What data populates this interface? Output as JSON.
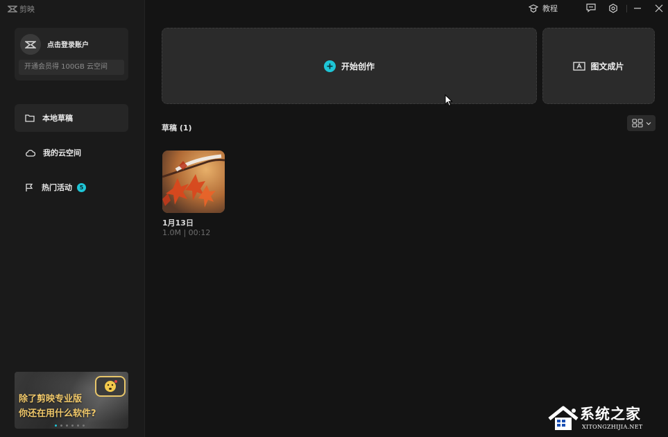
{
  "app": {
    "name": "剪映"
  },
  "account": {
    "login_label": "点击登录账户",
    "vip_promo": "开通会员得 100GB 云空间"
  },
  "sidebar": {
    "items": [
      {
        "label": "本地草稿",
        "icon": "folder-icon",
        "active": true
      },
      {
        "label": "我的云空间",
        "icon": "cloud-icon",
        "active": false
      },
      {
        "label": "热门活动",
        "icon": "flag-icon",
        "active": false,
        "badge": "5"
      }
    ]
  },
  "promo_banner": {
    "line1": "除了剪映专业版",
    "line2": "你还在用什么软件?"
  },
  "topbar": {
    "tutorial_label": "教程"
  },
  "main": {
    "create_label": "开始创作",
    "text_to_video_label": "图文成片",
    "drafts_title": "草稿 (1)",
    "drafts": [
      {
        "name": "1月13日",
        "meta": "1.0M | 00:12"
      }
    ]
  },
  "watermark": {
    "text": "系统之家",
    "sub": "XITONGZHIJIA.NET"
  },
  "colors": {
    "accent": "#1ec5d6",
    "background": "#141414",
    "sidebar": "#1a1a1a",
    "card": "#2b2b2b"
  }
}
